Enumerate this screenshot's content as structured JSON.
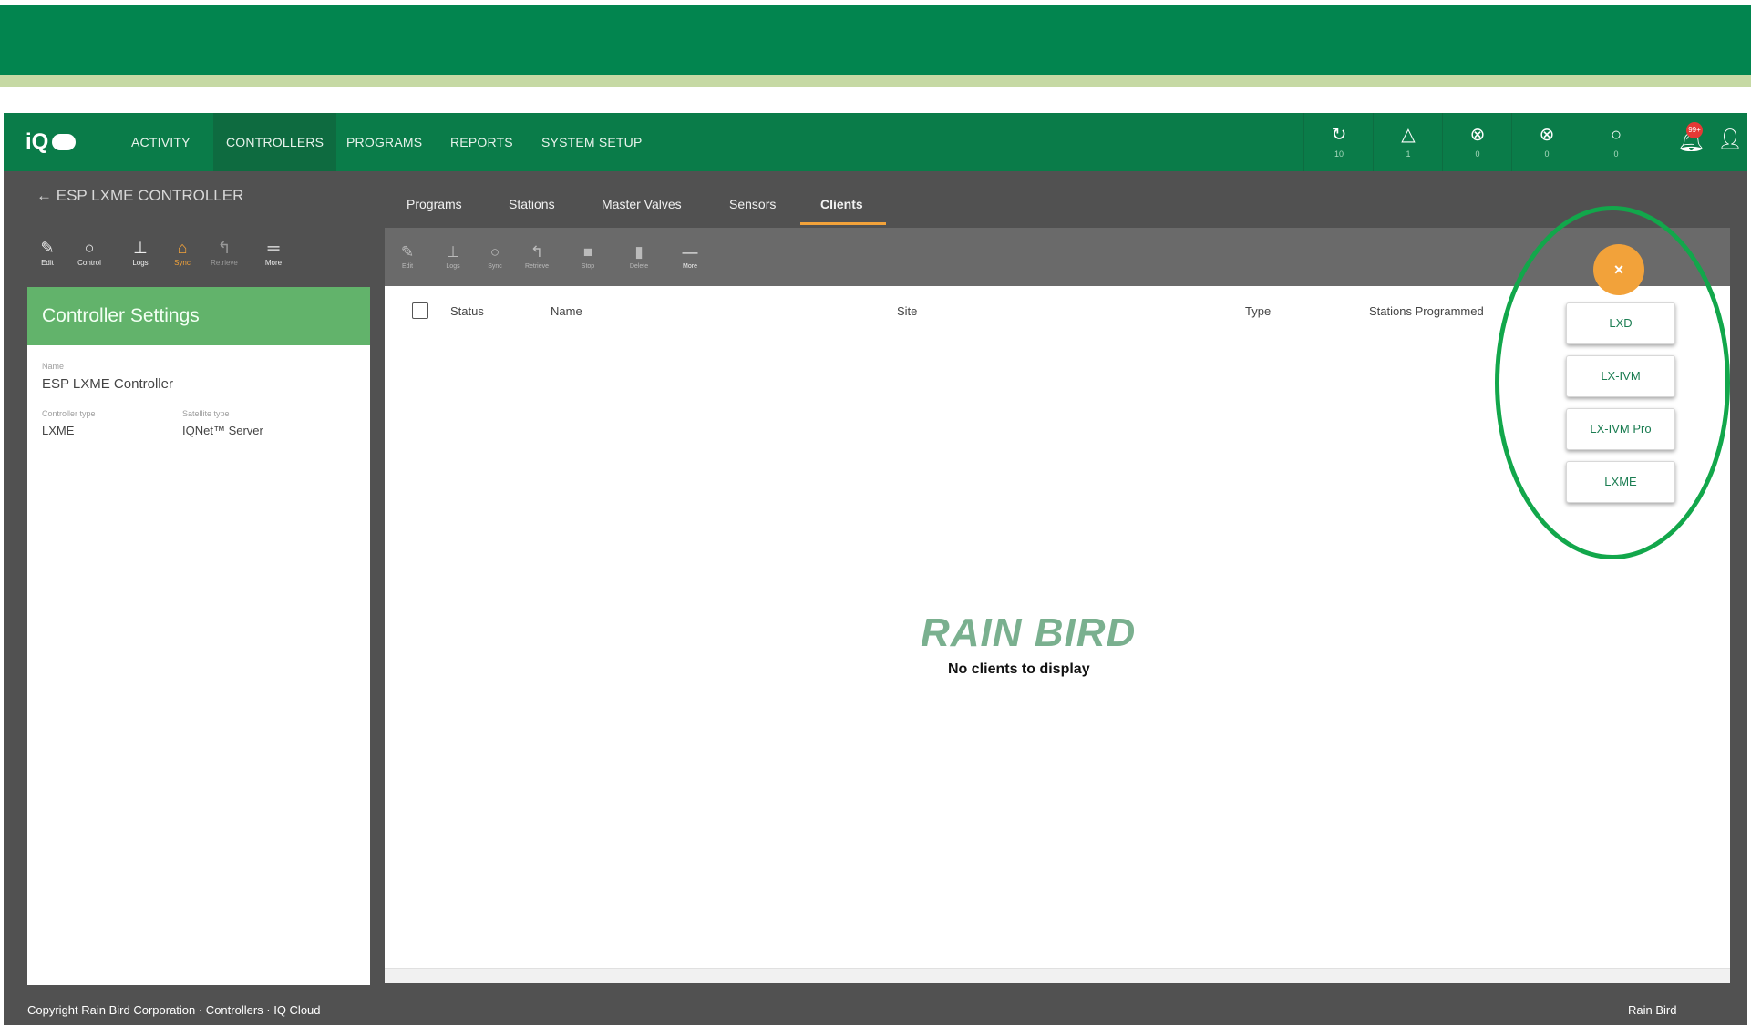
{
  "nav": {
    "logo": "iQ",
    "links": [
      "ACTIVITY",
      "CONTROLLERS",
      "PROGRAMS",
      "REPORTS",
      "SYSTEM SETUP"
    ],
    "status_counts": [
      "10",
      "1",
      "0",
      "0",
      "0"
    ],
    "notification_badge": "99+"
  },
  "left": {
    "back_label": "ESP LXME CONTROLLER",
    "tools": [
      "Edit",
      "Control",
      "Logs",
      "Sync",
      "Retrieve",
      "More"
    ],
    "settings": {
      "title": "Controller Settings",
      "name_label": "Name",
      "name_value": "ESP LXME Controller",
      "type_label": "Controller type",
      "type_value": "LXME",
      "server_label": "Satellite type",
      "server_value": "IQNet™ Server"
    }
  },
  "tabs": [
    "Programs",
    "Stations",
    "Master Valves",
    "Sensors",
    "Clients"
  ],
  "active_tab": "Clients",
  "toolbar": [
    "Edit",
    "Logs",
    "Sync",
    "Retrieve",
    "Stop",
    "Delete",
    "More"
  ],
  "table": {
    "columns": [
      "Status",
      "Name",
      "Site",
      "Type",
      "Stations Programmed"
    ],
    "empty_message": "No clients to display"
  },
  "brand": "RAIN BIRD",
  "fab": {
    "close": "×",
    "options": [
      "LXD",
      "LX-IVM",
      "LX-IVM Pro",
      "LXME"
    ]
  },
  "footer": {
    "left": "Copyright Rain Bird Corporation · Controllers · IQ Cloud",
    "right": "Rain Bird"
  }
}
